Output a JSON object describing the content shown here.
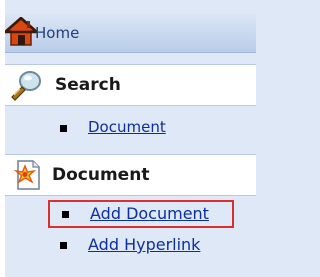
{
  "home": {
    "label": "Home",
    "icon": "home-icon"
  },
  "sections": {
    "search": {
      "title": "Search",
      "icon": "magnifier-icon",
      "items": [
        {
          "label": "Document"
        }
      ]
    },
    "document": {
      "title": "Document",
      "icon": "new-document-icon",
      "items": [
        {
          "label": "Add Document",
          "highlighted": true
        },
        {
          "label": "Add Hyperlink"
        }
      ]
    }
  },
  "colors": {
    "background": "#dfe8f6",
    "link": "#0b2f9e",
    "highlight_border": "#d8322f",
    "home_text": "#1f3f7a"
  }
}
